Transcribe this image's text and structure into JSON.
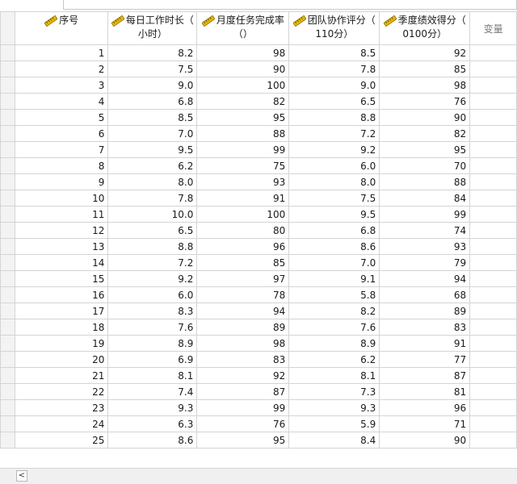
{
  "columns": [
    {
      "line1": "序号",
      "line2": ""
    },
    {
      "line1": "每日工作时长（",
      "line2": "小时）"
    },
    {
      "line1": "月度任务完成率",
      "line2": "（）"
    },
    {
      "line1": "团队协作评分（",
      "line2": "110分）"
    },
    {
      "line1": "季度绩效得分（",
      "line2": "0100分）"
    }
  ],
  "var_label": "变量",
  "column_icon": "ruler-icon",
  "rows": [
    [
      "1",
      "8.2",
      "98",
      "8.5",
      "92"
    ],
    [
      "2",
      "7.5",
      "90",
      "7.8",
      "85"
    ],
    [
      "3",
      "9.0",
      "100",
      "9.0",
      "98"
    ],
    [
      "4",
      "6.8",
      "82",
      "6.5",
      "76"
    ],
    [
      "5",
      "8.5",
      "95",
      "8.8",
      "90"
    ],
    [
      "6",
      "7.0",
      "88",
      "7.2",
      "82"
    ],
    [
      "7",
      "9.5",
      "99",
      "9.2",
      "95"
    ],
    [
      "8",
      "6.2",
      "75",
      "6.0",
      "70"
    ],
    [
      "9",
      "8.0",
      "93",
      "8.0",
      "88"
    ],
    [
      "10",
      "7.8",
      "91",
      "7.5",
      "84"
    ],
    [
      "11",
      "10.0",
      "100",
      "9.5",
      "99"
    ],
    [
      "12",
      "6.5",
      "80",
      "6.8",
      "74"
    ],
    [
      "13",
      "8.8",
      "96",
      "8.6",
      "93"
    ],
    [
      "14",
      "7.2",
      "85",
      "7.0",
      "79"
    ],
    [
      "15",
      "9.2",
      "97",
      "9.1",
      "94"
    ],
    [
      "16",
      "6.0",
      "78",
      "5.8",
      "68"
    ],
    [
      "17",
      "8.3",
      "94",
      "8.2",
      "89"
    ],
    [
      "18",
      "7.6",
      "89",
      "7.6",
      "83"
    ],
    [
      "19",
      "8.9",
      "98",
      "8.9",
      "91"
    ],
    [
      "20",
      "6.9",
      "83",
      "6.2",
      "77"
    ],
    [
      "21",
      "8.1",
      "92",
      "8.1",
      "87"
    ],
    [
      "22",
      "7.4",
      "87",
      "7.3",
      "81"
    ],
    [
      "23",
      "9.3",
      "99",
      "9.3",
      "96"
    ],
    [
      "24",
      "6.3",
      "76",
      "5.9",
      "71"
    ],
    [
      "25",
      "8.6",
      "95",
      "8.4",
      "90"
    ]
  ],
  "scroll_left_glyph": "<",
  "colors": {
    "grid_line": "#d4d4d4",
    "ruler_icon": "#e6b800",
    "header_bg": "#ffffff"
  }
}
